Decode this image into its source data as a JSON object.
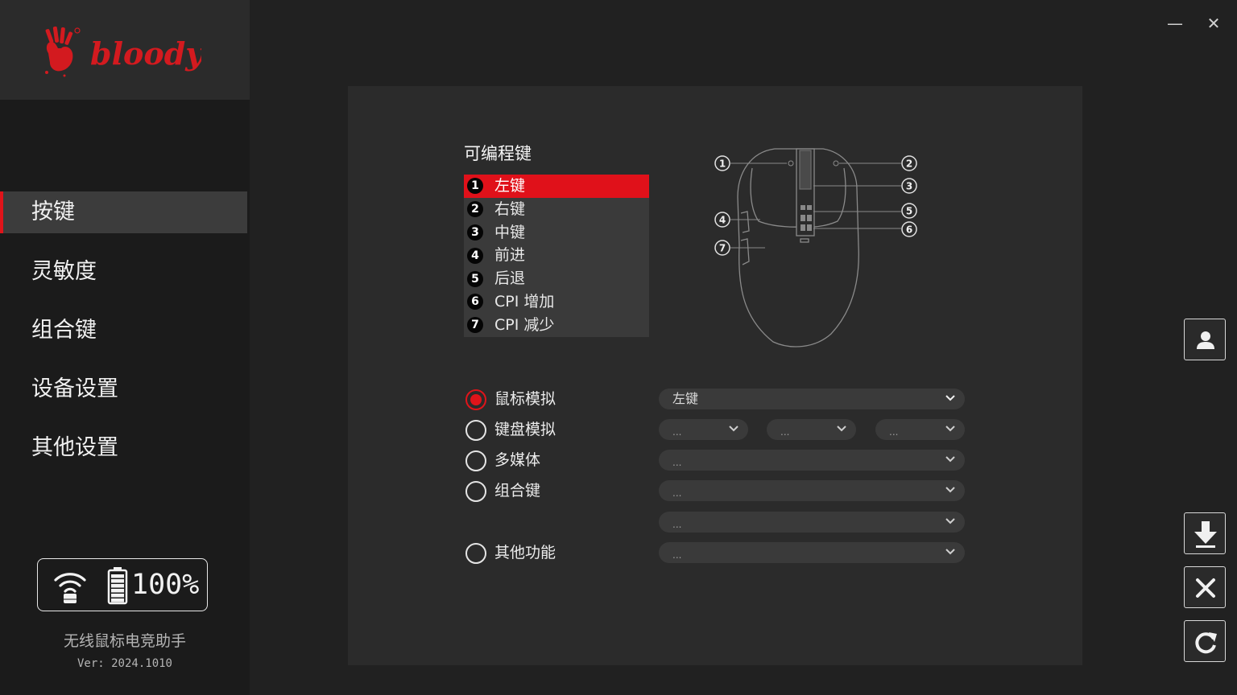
{
  "brand": {
    "logo_text": "bloody",
    "logo_color": "#d31a1f"
  },
  "window_controls": {
    "minimize": "—",
    "close": "✕"
  },
  "nav": {
    "items": [
      {
        "label": "按键",
        "active": true
      },
      {
        "label": "灵敏度",
        "active": false
      },
      {
        "label": "组合键",
        "active": false
      },
      {
        "label": "设备设置",
        "active": false
      },
      {
        "label": "其他设置",
        "active": false
      }
    ]
  },
  "status": {
    "battery_percent": "100%",
    "battery_level": 1.0,
    "connection": "wireless"
  },
  "app": {
    "name": "无线鼠标电竞助手",
    "version": "Ver: 2024.1010"
  },
  "panel": {
    "title": "可编程键",
    "keys": [
      {
        "num": "1",
        "label": "左键",
        "active": true
      },
      {
        "num": "2",
        "label": "右键",
        "active": false
      },
      {
        "num": "3",
        "label": "中键",
        "active": false
      },
      {
        "num": "4",
        "label": "前进",
        "active": false
      },
      {
        "num": "5",
        "label": "后退",
        "active": false
      },
      {
        "num": "6",
        "label": "CPI 增加",
        "active": false
      },
      {
        "num": "7",
        "label": "CPI 减少",
        "active": false
      }
    ],
    "diagram_callouts": [
      "1",
      "2",
      "3",
      "4",
      "5",
      "6",
      "7"
    ],
    "options": [
      {
        "label": "鼠标模拟",
        "checked": true
      },
      {
        "label": "键盘模拟",
        "checked": false
      },
      {
        "label": "多媒体",
        "checked": false
      },
      {
        "label": "组合键",
        "checked": false
      },
      {
        "label": "其他功能",
        "checked": false
      }
    ],
    "dropdowns": {
      "mouse_sim": "左键",
      "keyboard_sim": [
        "...",
        "...",
        "..."
      ],
      "multimedia": "...",
      "combo_1": "...",
      "combo_2": "...",
      "other": "..."
    }
  },
  "accent_color": "#e0141a",
  "side_buttons": [
    "user-icon",
    "download-icon",
    "close-icon",
    "refresh-icon"
  ]
}
